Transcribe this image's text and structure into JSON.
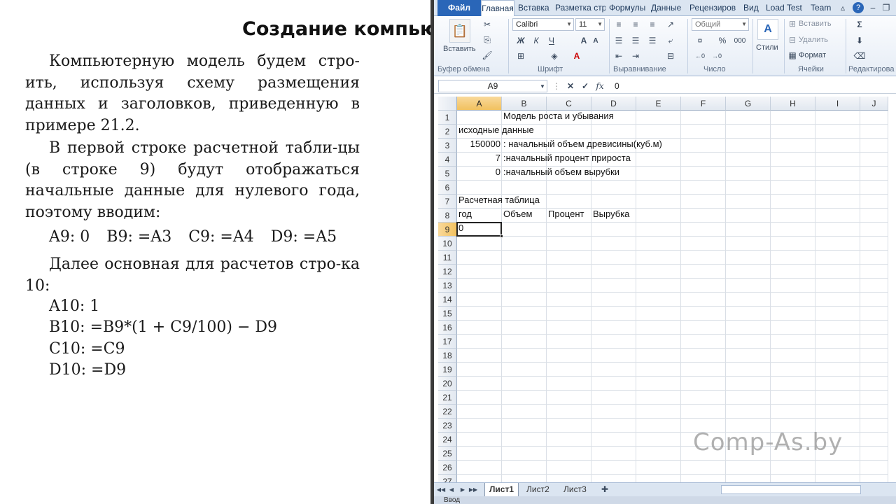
{
  "doc": {
    "title": "Создание компьют",
    "p1": "Компьютерную модель будем стро-ить, используя схему размещения данных и заголовков, приведенную в примере 21.2.",
    "p2": "В первой строке расчетной табли-цы (в строке 9) будут отображаться начальные данные для нулевого года, поэтому вводим:",
    "cells": [
      "A9: 0",
      "B9: =A3",
      "C9: =A4",
      "D9: =A5"
    ],
    "p3": "Далее основная для расчетов стро-ка 10:",
    "formulas": [
      "A10: 1",
      "B10: =B9*(1 + C9/100) − D9",
      "C10: =C9",
      "D10: =D9"
    ]
  },
  "excel": {
    "tabs": {
      "file": "Файл",
      "home": "Главная",
      "insert": "Вставка",
      "layout": "Разметка стр",
      "formulas": "Формулы",
      "data": "Данные",
      "review": "Рецензиров",
      "view": "Вид",
      "loadtest": "Load Test",
      "team": "Team"
    },
    "ribbon": {
      "paste": "Вставить",
      "clipboard": "Буфер обмена",
      "font_name": "Calibri",
      "font_size": "11",
      "font": "Шрифт",
      "bold": "Ж",
      "italic": "К",
      "underline": "Ч",
      "alignment": "Выравнивание",
      "number_format": "Общий",
      "number": "Число",
      "styles": "Стили",
      "cells_insert": "Вставить",
      "cells_delete": "Удалить",
      "cells_format": "Формат",
      "cells": "Ячейки",
      "editing": "Редактирова"
    },
    "namebox": "A9",
    "formula": "0",
    "columns": [
      "A",
      "B",
      "C",
      "D",
      "E",
      "F",
      "G",
      "H",
      "I",
      "J"
    ],
    "rows": [
      "1",
      "2",
      "3",
      "4",
      "5",
      "6",
      "7",
      "8",
      "9",
      "10",
      "11",
      "12",
      "13",
      "14",
      "15",
      "16",
      "17",
      "18",
      "19",
      "20",
      "21",
      "22",
      "23",
      "24",
      "25",
      "26",
      "27"
    ],
    "cells": {
      "b1": "Модель роста и убывания",
      "a2": "исходные данные",
      "a3": "150000",
      "b3": ": начальный объем древисины(куб.м)",
      "a4": "7",
      "b4": ":начальный процент прироста",
      "a5": "0",
      "b5": ":начальный объем вырубки",
      "a7": "Расчетная таблица",
      "a8": "год",
      "b8": "Объем",
      "c8": "Процент",
      "d8": "Вырубка",
      "a9": "0"
    },
    "sheets": [
      "Лист1",
      "Лист2",
      "Лист3"
    ],
    "status": "Ввод"
  },
  "watermark": "Comp-As.by"
}
